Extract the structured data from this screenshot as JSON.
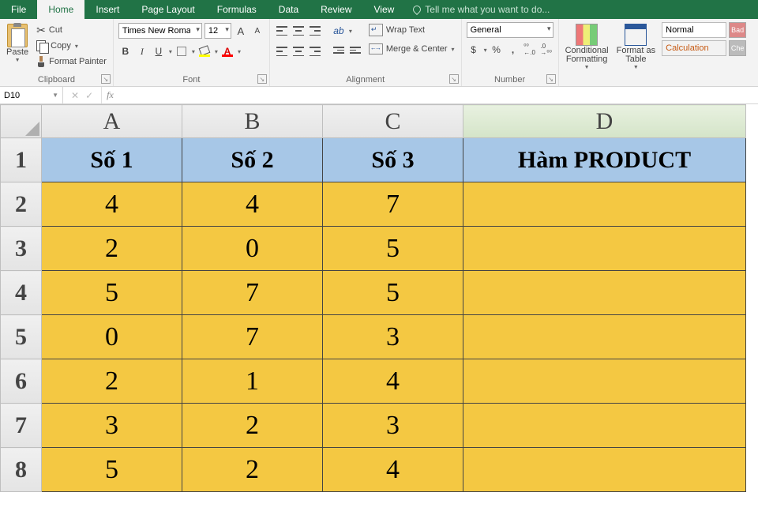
{
  "tabs": {
    "file": "File",
    "home": "Home",
    "insert": "Insert",
    "page_layout": "Page Layout",
    "formulas": "Formulas",
    "data": "Data",
    "review": "Review",
    "view": "View",
    "tell_me": "Tell me what you want to do..."
  },
  "ribbon": {
    "clipboard": {
      "paste": "Paste",
      "cut": "Cut",
      "copy": "Copy",
      "format_painter": "Format Painter",
      "label": "Clipboard"
    },
    "font": {
      "font_name": "Times New Roma",
      "font_size": "12",
      "increase_A": "A",
      "decrease_A": "A",
      "bold": "B",
      "italic": "I",
      "underline": "U",
      "font_color_letter": "A",
      "label": "Font"
    },
    "alignment": {
      "wrap": "Wrap Text",
      "merge": "Merge & Center",
      "label": "Alignment"
    },
    "number": {
      "format": "General",
      "currency": "$",
      "percent": "%",
      "comma": ",",
      "inc_dec": ".0 .00",
      "dec_dec": ".00 .0",
      "label": "Number"
    },
    "styles": {
      "conditional": "Conditional\nFormatting",
      "format_as": "Format as\nTable",
      "normal": "Normal",
      "calculation": "Calculation",
      "bad": "Bad",
      "check": "Che"
    }
  },
  "name_box": "D10",
  "fx": {
    "cancel": "✕",
    "enter": "✓",
    "insert_fn": "fx"
  },
  "formula_value": "",
  "columns": [
    "A",
    "B",
    "C",
    "D"
  ],
  "row_headers": [
    "1",
    "2",
    "3",
    "4",
    "5",
    "6",
    "7",
    "8"
  ],
  "headers": {
    "A": "Số 1",
    "B": "Số 2",
    "C": "Số 3",
    "D": "Hàm PRODUCT"
  },
  "data_rows": [
    {
      "A": "4",
      "B": "4",
      "C": "7",
      "D": ""
    },
    {
      "A": "2",
      "B": "0",
      "C": "5",
      "D": ""
    },
    {
      "A": "5",
      "B": "7",
      "C": "5",
      "D": ""
    },
    {
      "A": "0",
      "B": "7",
      "C": "3",
      "D": ""
    },
    {
      "A": "2",
      "B": "1",
      "C": "4",
      "D": ""
    },
    {
      "A": "3",
      "B": "2",
      "C": "3",
      "D": ""
    },
    {
      "A": "5",
      "B": "2",
      "C": "4",
      "D": ""
    }
  ],
  "selected_column": "D"
}
